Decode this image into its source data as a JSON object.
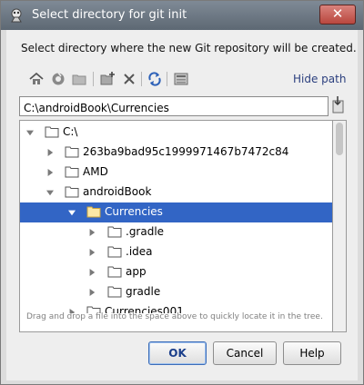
{
  "window": {
    "title": "Select directory for git init",
    "close_glyph": "✕"
  },
  "description": "Select directory where the new Git repository will be created.",
  "toolbar": {
    "icons": [
      "home-icon",
      "project-icon",
      "module-folder-icon",
      "new-folder-icon",
      "delete-icon",
      "refresh-icon",
      "show-hidden-icon"
    ],
    "hide_path_label": "Hide path"
  },
  "path_field": {
    "value": "C:\\androidBook\\Currencies"
  },
  "tree": {
    "items": [
      {
        "label": "C:\\",
        "expanded": true
      },
      {
        "label": "263ba9bad95c1999971467b7472c84",
        "expanded": false
      },
      {
        "label": "AMD",
        "expanded": false
      },
      {
        "label": "androidBook",
        "expanded": true
      },
      {
        "label": "Currencies",
        "expanded": true,
        "selected": true
      },
      {
        "label": ".gradle",
        "expanded": false
      },
      {
        "label": ".idea",
        "expanded": false
      },
      {
        "label": "app",
        "expanded": false
      },
      {
        "label": "gradle",
        "expanded": false
      },
      {
        "label": "Currencies001",
        "expanded": false
      }
    ]
  },
  "hint": "Drag and drop a file into the space above to quickly locate it in the tree.",
  "buttons": {
    "ok": "OK",
    "cancel": "Cancel",
    "help": "Help"
  },
  "colors": {
    "selection": "#3265c5",
    "titlebar": "#6c7782",
    "link": "#2b3f7e"
  }
}
